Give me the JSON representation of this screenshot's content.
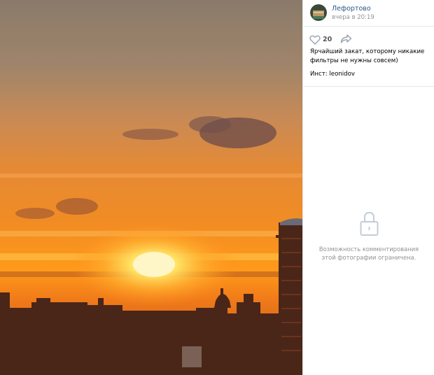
{
  "post": {
    "author": "Лефортово",
    "date": "вчера в 20:19",
    "likes": "20",
    "text": "Ярчайший закат, которому никакие фильтры не нужны совсем)",
    "insta": "Инст: leonidov"
  },
  "comments": {
    "restricted_text": "Возможность комментирования этой фотографии ограничена."
  },
  "icons": {
    "like": "heart-icon",
    "share": "share-arrow-icon",
    "lock": "lock-icon"
  },
  "colors": {
    "link": "#2a5885",
    "muted": "#939393",
    "divider": "#e7e8ec"
  }
}
